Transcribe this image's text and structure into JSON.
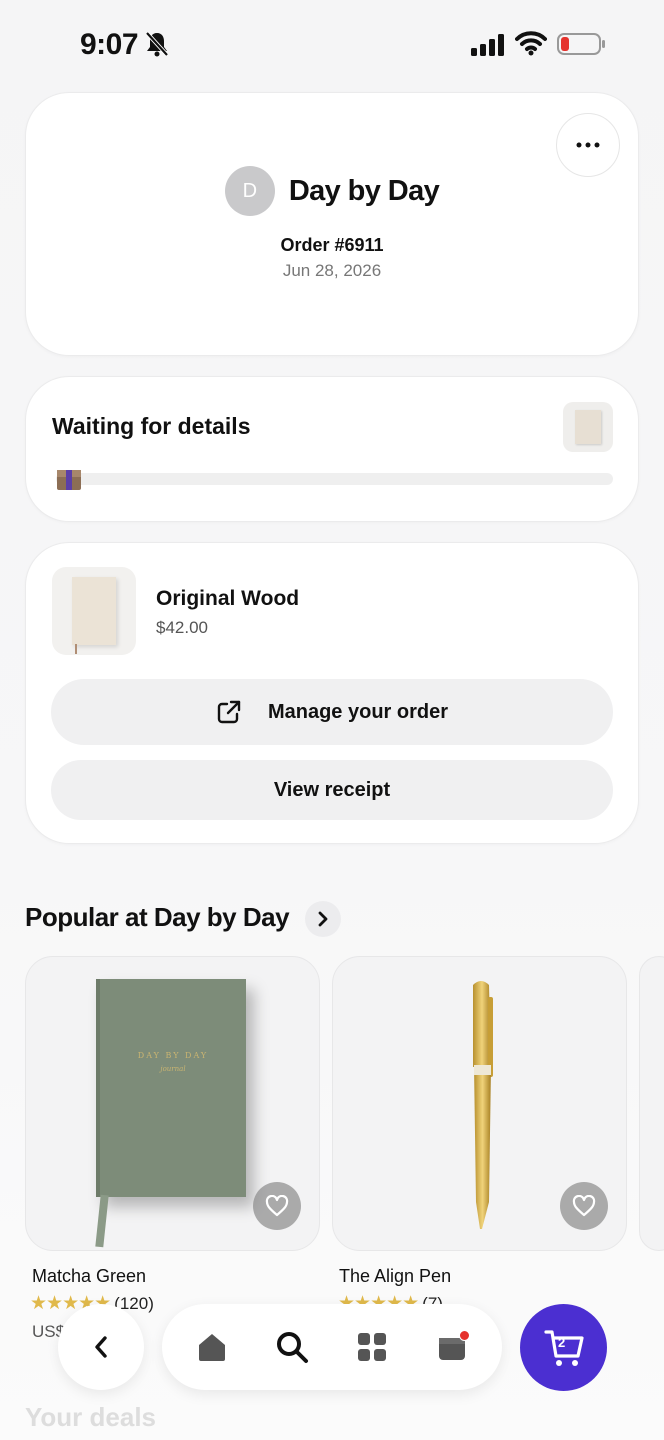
{
  "status_bar": {
    "time": "9:07"
  },
  "shop": {
    "avatar_initial": "D",
    "name": "Day by Day",
    "order_number": "Order #6911",
    "order_date": "Jun 28, 2026"
  },
  "shipment": {
    "status_title": "Waiting for details",
    "progress": 0.0
  },
  "order_item": {
    "name": "Original Wood",
    "price": "$42.00"
  },
  "actions": {
    "manage_label": "Manage your order",
    "receipt_label": "View receipt"
  },
  "popular": {
    "title": "Popular at Day by Day",
    "products": [
      {
        "name": "Matcha Green",
        "rating_count": "(120)",
        "price": "US$",
        "journal_title": "DAY BY DAY",
        "journal_subtitle": "journal"
      },
      {
        "name": "The Align Pen",
        "rating_count": "(7)"
      }
    ]
  },
  "next_section": {
    "title": "Your deals"
  },
  "cart": {
    "count": "2"
  },
  "colors": {
    "accent": "#4b2fd1",
    "star": "#e0b94b",
    "notification": "#e5322d"
  },
  "icons": [
    "bell-slash-icon",
    "signal-icon",
    "wifi-icon",
    "battery-icon",
    "more-icon",
    "box-icon",
    "external-link-icon",
    "chevron-right-icon",
    "heart-icon",
    "back-icon",
    "home-icon",
    "search-icon",
    "categories-icon",
    "deals-icon",
    "cart-icon"
  ]
}
